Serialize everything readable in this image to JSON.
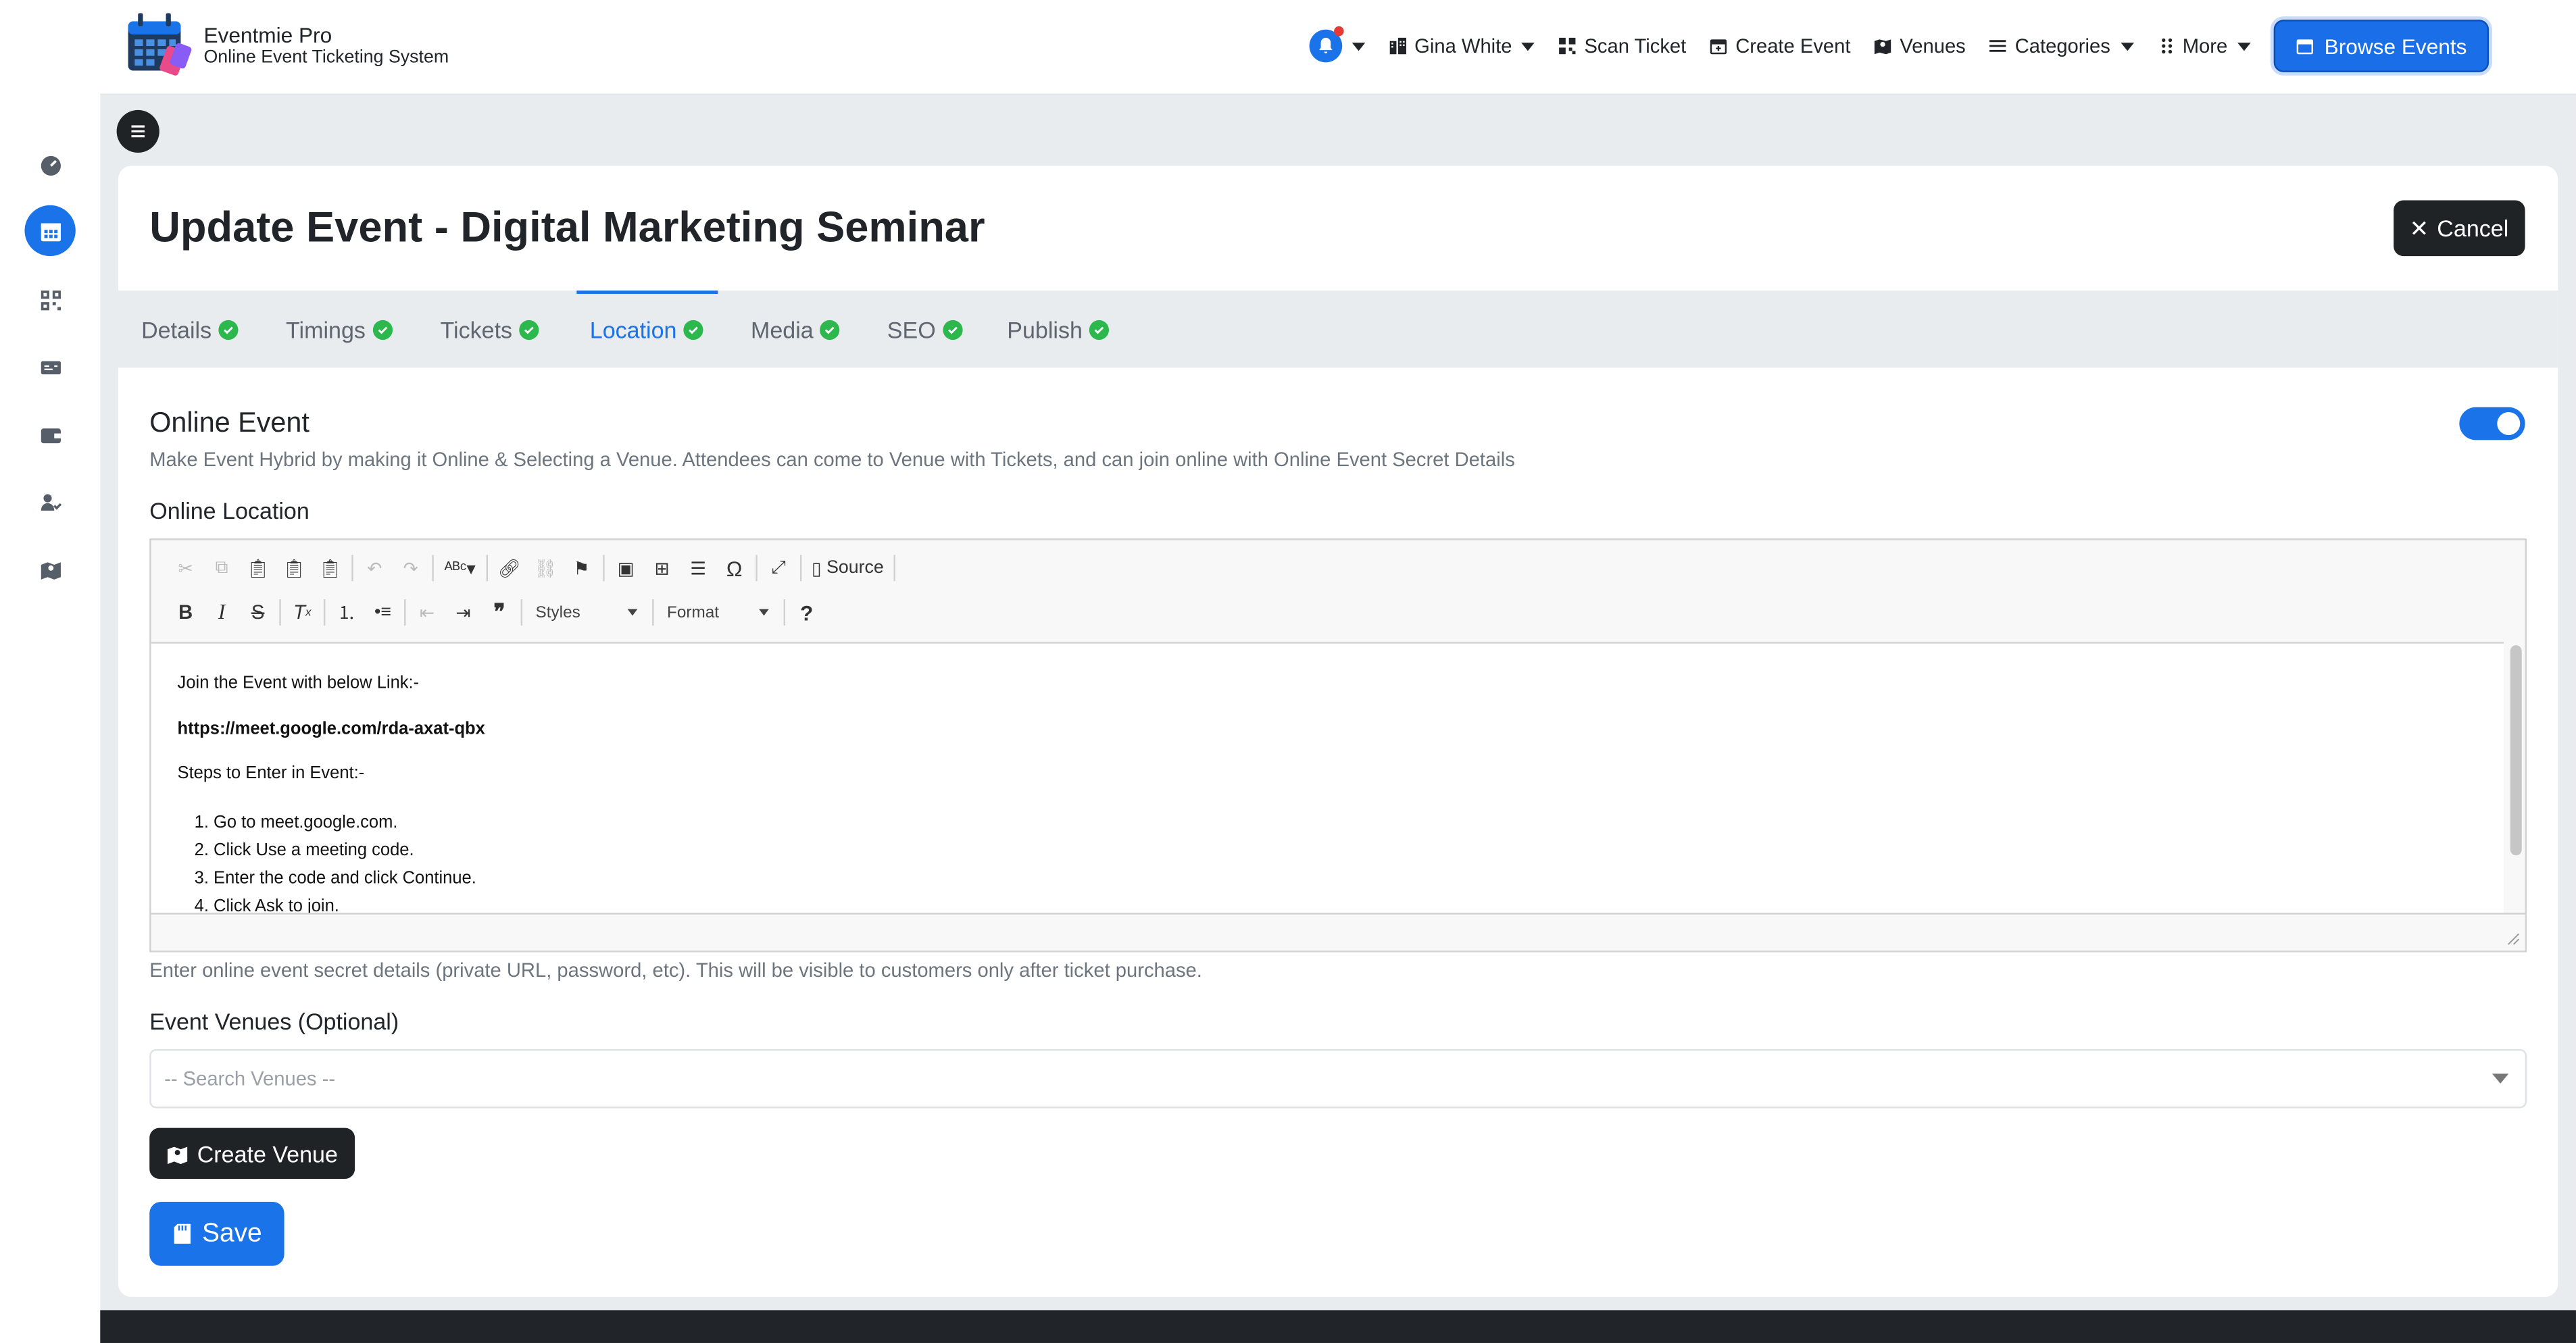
{
  "brand": {
    "name": "Eventmie Pro",
    "tagline": "Online Event Ticketing System"
  },
  "nav": {
    "user": "Gina White",
    "scan_ticket": "Scan Ticket",
    "create_event": "Create Event",
    "venues": "Venues",
    "categories": "Categories",
    "more": "More",
    "browse_events": "Browse Events"
  },
  "sidebar": {
    "items": [
      "dashboard-icon",
      "calendar-icon",
      "qrcode-icon",
      "ticket-icon",
      "wallet-icon",
      "users-icon",
      "map-icon"
    ],
    "active_index": 1
  },
  "page": {
    "title": "Update Event - Digital Marketing Seminar",
    "cancel_label": "Cancel"
  },
  "tabs": [
    {
      "label": "Details",
      "done": true
    },
    {
      "label": "Timings",
      "done": true
    },
    {
      "label": "Tickets",
      "done": true
    },
    {
      "label": "Location",
      "done": true,
      "active": true
    },
    {
      "label": "Media",
      "done": true
    },
    {
      "label": "SEO",
      "done": true
    },
    {
      "label": "Publish",
      "done": true
    }
  ],
  "online_event": {
    "title": "Online Event",
    "description": "Make Event Hybrid by making it Online & Selecting a Venue. Attendees can come to Venue with Tickets, and can join online with Online Event Secret Details",
    "enabled": true
  },
  "online_location": {
    "label": "Online Location",
    "toolbar": {
      "source": "Source",
      "styles": "Styles",
      "format": "Format"
    },
    "content": {
      "line1": "Join the Event with below Link:-",
      "link": "https://meet.google.com/rda-axat-qbx",
      "steps_heading": "Steps to Enter in Event:-",
      "steps": [
        "Go to meet.google.com.",
        "Click Use a meeting code.",
        "Enter the code and click Continue.",
        "Click Ask to join."
      ]
    },
    "help": "Enter online event secret details (private URL, password, etc). This will be visible to customers only after ticket purchase."
  },
  "venues": {
    "label": "Event Venues (Optional)",
    "placeholder": "-- Search Venues --",
    "create_label": "Create Venue"
  },
  "save_label": "Save",
  "colors": {
    "primary": "#1a73e8",
    "dark": "#1f2326",
    "success": "#2db84d"
  }
}
